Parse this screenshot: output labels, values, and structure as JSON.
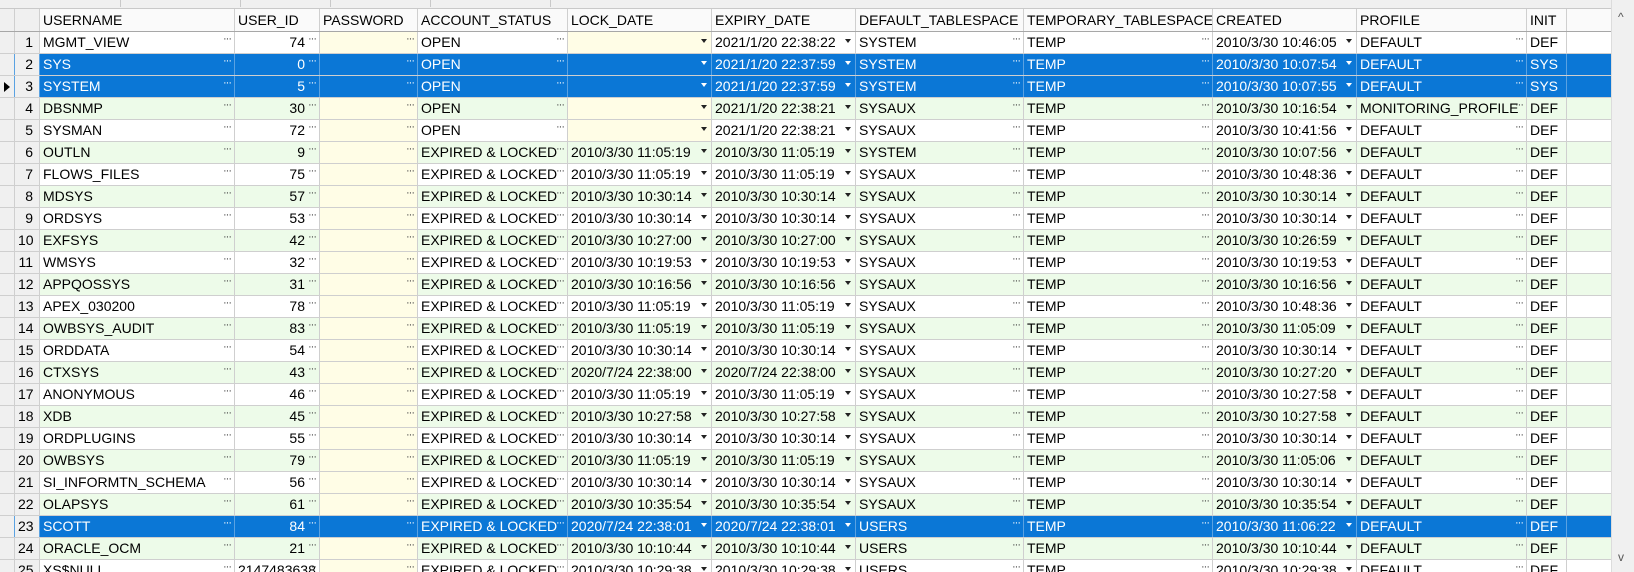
{
  "columns": [
    "USERNAME",
    "USER_ID",
    "PASSWORD",
    "ACCOUNT_STATUS",
    "LOCK_DATE",
    "EXPIRY_DATE",
    "DEFAULT_TABLESPACE",
    "TEMPORARY_TABLESPACE",
    "CREATED",
    "PROFILE",
    "INIT"
  ],
  "rows": [
    {
      "n": "1",
      "user": "MGMT_VIEW",
      "id": "74",
      "status": "OPEN",
      "lock": "",
      "expiry": "2021/1/20 22:38:22",
      "dts": "SYSTEM",
      "tts": "TEMP",
      "created": "2010/3/30 10:46:05",
      "profile": "DEFAULT",
      "init": "DEF"
    },
    {
      "n": "2",
      "user": "SYS",
      "id": "0",
      "status": "OPEN",
      "lock": "",
      "expiry": "2021/1/20 22:37:59",
      "dts": "SYSTEM",
      "tts": "TEMP",
      "created": "2010/3/30 10:07:54",
      "profile": "DEFAULT",
      "init": "SYS",
      "selected": true
    },
    {
      "n": "3",
      "user": "SYSTEM",
      "id": "5",
      "status": "OPEN",
      "lock": "",
      "expiry": "2021/1/20 22:37:59",
      "dts": "SYSTEM",
      "tts": "TEMP",
      "created": "2010/3/30 10:07:55",
      "profile": "DEFAULT",
      "init": "SYS",
      "selected": true,
      "current": true
    },
    {
      "n": "4",
      "user": "DBSNMP",
      "id": "30",
      "status": "OPEN",
      "lock": "",
      "expiry": "2021/1/20 22:38:21",
      "dts": "SYSAUX",
      "tts": "TEMP",
      "created": "2010/3/30 10:16:54",
      "profile": "MONITORING_PROFILE",
      "init": "DEF"
    },
    {
      "n": "5",
      "user": "SYSMAN",
      "id": "72",
      "status": "OPEN",
      "lock": "",
      "expiry": "2021/1/20 22:38:21",
      "dts": "SYSAUX",
      "tts": "TEMP",
      "created": "2010/3/30 10:41:56",
      "profile": "DEFAULT",
      "init": "DEF"
    },
    {
      "n": "6",
      "user": "OUTLN",
      "id": "9",
      "status": "EXPIRED & LOCKED",
      "lock": "2010/3/30 11:05:19",
      "expiry": "2010/3/30 11:05:19",
      "dts": "SYSTEM",
      "tts": "TEMP",
      "created": "2010/3/30 10:07:56",
      "profile": "DEFAULT",
      "init": "DEF"
    },
    {
      "n": "7",
      "user": "FLOWS_FILES",
      "id": "75",
      "status": "EXPIRED & LOCKED",
      "lock": "2010/3/30 11:05:19",
      "expiry": "2010/3/30 11:05:19",
      "dts": "SYSAUX",
      "tts": "TEMP",
      "created": "2010/3/30 10:48:36",
      "profile": "DEFAULT",
      "init": "DEF"
    },
    {
      "n": "8",
      "user": "MDSYS",
      "id": "57",
      "status": "EXPIRED & LOCKED",
      "lock": "2010/3/30 10:30:14",
      "expiry": "2010/3/30 10:30:14",
      "dts": "SYSAUX",
      "tts": "TEMP",
      "created": "2010/3/30 10:30:14",
      "profile": "DEFAULT",
      "init": "DEF"
    },
    {
      "n": "9",
      "user": "ORDSYS",
      "id": "53",
      "status": "EXPIRED & LOCKED",
      "lock": "2010/3/30 10:30:14",
      "expiry": "2010/3/30 10:30:14",
      "dts": "SYSAUX",
      "tts": "TEMP",
      "created": "2010/3/30 10:30:14",
      "profile": "DEFAULT",
      "init": "DEF"
    },
    {
      "n": "10",
      "user": "EXFSYS",
      "id": "42",
      "status": "EXPIRED & LOCKED",
      "lock": "2010/3/30 10:27:00",
      "expiry": "2010/3/30 10:27:00",
      "dts": "SYSAUX",
      "tts": "TEMP",
      "created": "2010/3/30 10:26:59",
      "profile": "DEFAULT",
      "init": "DEF"
    },
    {
      "n": "11",
      "user": "WMSYS",
      "id": "32",
      "status": "EXPIRED & LOCKED",
      "lock": "2010/3/30 10:19:53",
      "expiry": "2010/3/30 10:19:53",
      "dts": "SYSAUX",
      "tts": "TEMP",
      "created": "2010/3/30 10:19:53",
      "profile": "DEFAULT",
      "init": "DEF"
    },
    {
      "n": "12",
      "user": "APPQOSSYS",
      "id": "31",
      "status": "EXPIRED & LOCKED",
      "lock": "2010/3/30 10:16:56",
      "expiry": "2010/3/30 10:16:56",
      "dts": "SYSAUX",
      "tts": "TEMP",
      "created": "2010/3/30 10:16:56",
      "profile": "DEFAULT",
      "init": "DEF"
    },
    {
      "n": "13",
      "user": "APEX_030200",
      "id": "78",
      "status": "EXPIRED & LOCKED",
      "lock": "2010/3/30 11:05:19",
      "expiry": "2010/3/30 11:05:19",
      "dts": "SYSAUX",
      "tts": "TEMP",
      "created": "2010/3/30 10:48:36",
      "profile": "DEFAULT",
      "init": "DEF"
    },
    {
      "n": "14",
      "user": "OWBSYS_AUDIT",
      "id": "83",
      "status": "EXPIRED & LOCKED",
      "lock": "2010/3/30 11:05:19",
      "expiry": "2010/3/30 11:05:19",
      "dts": "SYSAUX",
      "tts": "TEMP",
      "created": "2010/3/30 11:05:09",
      "profile": "DEFAULT",
      "init": "DEF"
    },
    {
      "n": "15",
      "user": "ORDDATA",
      "id": "54",
      "status": "EXPIRED & LOCKED",
      "lock": "2010/3/30 10:30:14",
      "expiry": "2010/3/30 10:30:14",
      "dts": "SYSAUX",
      "tts": "TEMP",
      "created": "2010/3/30 10:30:14",
      "profile": "DEFAULT",
      "init": "DEF"
    },
    {
      "n": "16",
      "user": "CTXSYS",
      "id": "43",
      "status": "EXPIRED & LOCKED",
      "lock": "2020/7/24 22:38:00",
      "expiry": "2020/7/24 22:38:00",
      "dts": "SYSAUX",
      "tts": "TEMP",
      "created": "2010/3/30 10:27:20",
      "profile": "DEFAULT",
      "init": "DEF"
    },
    {
      "n": "17",
      "user": "ANONYMOUS",
      "id": "46",
      "status": "EXPIRED & LOCKED",
      "lock": "2010/3/30 11:05:19",
      "expiry": "2010/3/30 11:05:19",
      "dts": "SYSAUX",
      "tts": "TEMP",
      "created": "2010/3/30 10:27:58",
      "profile": "DEFAULT",
      "init": "DEF"
    },
    {
      "n": "18",
      "user": "XDB",
      "id": "45",
      "status": "EXPIRED & LOCKED",
      "lock": "2010/3/30 10:27:58",
      "expiry": "2010/3/30 10:27:58",
      "dts": "SYSAUX",
      "tts": "TEMP",
      "created": "2010/3/30 10:27:58",
      "profile": "DEFAULT",
      "init": "DEF"
    },
    {
      "n": "19",
      "user": "ORDPLUGINS",
      "id": "55",
      "status": "EXPIRED & LOCKED",
      "lock": "2010/3/30 10:30:14",
      "expiry": "2010/3/30 10:30:14",
      "dts": "SYSAUX",
      "tts": "TEMP",
      "created": "2010/3/30 10:30:14",
      "profile": "DEFAULT",
      "init": "DEF"
    },
    {
      "n": "20",
      "user": "OWBSYS",
      "id": "79",
      "status": "EXPIRED & LOCKED",
      "lock": "2010/3/30 11:05:19",
      "expiry": "2010/3/30 11:05:19",
      "dts": "SYSAUX",
      "tts": "TEMP",
      "created": "2010/3/30 11:05:06",
      "profile": "DEFAULT",
      "init": "DEF"
    },
    {
      "n": "21",
      "user": "SI_INFORMTN_SCHEMA",
      "id": "56",
      "status": "EXPIRED & LOCKED",
      "lock": "2010/3/30 10:30:14",
      "expiry": "2010/3/30 10:30:14",
      "dts": "SYSAUX",
      "tts": "TEMP",
      "created": "2010/3/30 10:30:14",
      "profile": "DEFAULT",
      "init": "DEF"
    },
    {
      "n": "22",
      "user": "OLAPSYS",
      "id": "61",
      "status": "EXPIRED & LOCKED",
      "lock": "2010/3/30 10:35:54",
      "expiry": "2010/3/30 10:35:54",
      "dts": "SYSAUX",
      "tts": "TEMP",
      "created": "2010/3/30 10:35:54",
      "profile": "DEFAULT",
      "init": "DEF"
    },
    {
      "n": "23",
      "user": "SCOTT",
      "id": "84",
      "status": "EXPIRED & LOCKED",
      "lock": "2020/7/24 22:38:01",
      "expiry": "2020/7/24 22:38:01",
      "dts": "USERS",
      "tts": "TEMP",
      "created": "2010/3/30 11:06:22",
      "profile": "DEFAULT",
      "init": "DEF",
      "selected": true
    },
    {
      "n": "24",
      "user": "ORACLE_OCM",
      "id": "21",
      "status": "EXPIRED & LOCKED",
      "lock": "2010/3/30 10:10:44",
      "expiry": "2010/3/30 10:10:44",
      "dts": "USERS",
      "tts": "TEMP",
      "created": "2010/3/30 10:10:44",
      "profile": "DEFAULT",
      "init": "DEF"
    },
    {
      "n": "25",
      "user": "XS$NULL",
      "id": "2147483638",
      "status": "EXPIRED & LOCKED",
      "lock": "2010/3/30 10:29:38",
      "expiry": "2010/3/30 10:29:38",
      "dts": "USERS",
      "tts": "TEMP",
      "created": "2010/3/30 10:29:38",
      "profile": "DEFAULT",
      "init": "DEF"
    }
  ],
  "scrollbar": {
    "up_glyph": "^",
    "down_glyph": "v"
  },
  "colors": {
    "selection": "#0b77d6",
    "even_row": "#edfbe9",
    "editable_cell": "#fffde6"
  }
}
